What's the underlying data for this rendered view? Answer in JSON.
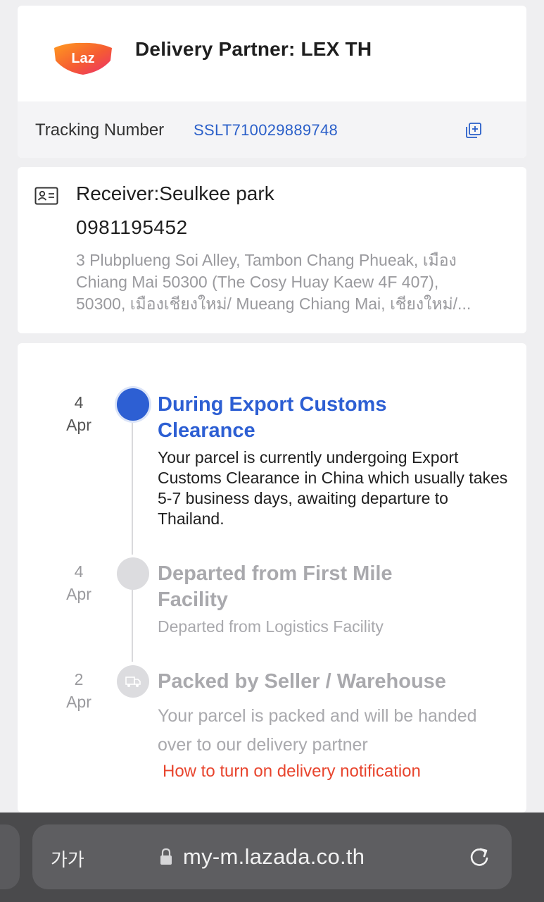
{
  "partner": {
    "logo_text": "Laz",
    "title": "Delivery Partner: LEX TH"
  },
  "tracking": {
    "label": "Tracking Number",
    "number": "SSLT710029889748",
    "copy_icon": "copy-icon"
  },
  "receiver": {
    "icon": "id-card-icon",
    "name": "Receiver:Seulkee park",
    "phone": "0981195452",
    "address_lines": [
      "3 Plubplueng Soi Alley, Tambon Chang Phueak, เมือง",
      "Chiang Mai 50300 (The Cosy Huay Kaew 4F 407),",
      "50300, เมืองเชียงใหม่/ Mueang Chiang Mai, เชียงใหม่/..."
    ]
  },
  "timeline": [
    {
      "day": "4",
      "month": "Apr",
      "title": "During Export Customs Clearance",
      "title_lines": [
        "During Export Customs",
        "Clearance"
      ],
      "description": "Your parcel is currently undergoing Export Customs Clearance in China which usually takes 5-7 business days, awaiting departure to Thailand.",
      "status": "active"
    },
    {
      "day": "4",
      "month": "Apr",
      "title": "Departed from First Mile Facility",
      "title_lines": [
        "Departed from First Mile",
        "Facility"
      ],
      "description": "Departed from Logistics Facility",
      "status": "done"
    },
    {
      "day": "2",
      "month": "Apr",
      "title": "Packed by Seller / Warehouse",
      "title_lines": [
        "Packed by Seller / Warehouse"
      ],
      "description": "Your parcel is packed and will be handed over to our delivery partner",
      "status": "done",
      "icon": "truck-icon"
    }
  ],
  "notification_link": "How to turn on delivery notification",
  "browser": {
    "aa_label": "가가",
    "url": "my-m.lazada.co.th",
    "lock_icon": "lock-icon",
    "reload_icon": "reload-icon"
  },
  "colors": {
    "accent_blue": "#2d5fd3",
    "link_blue": "#2a5fc9",
    "notification_red": "#e8452e",
    "logo_orange": "#f36c21",
    "logo_pink": "#ec2f6e"
  }
}
